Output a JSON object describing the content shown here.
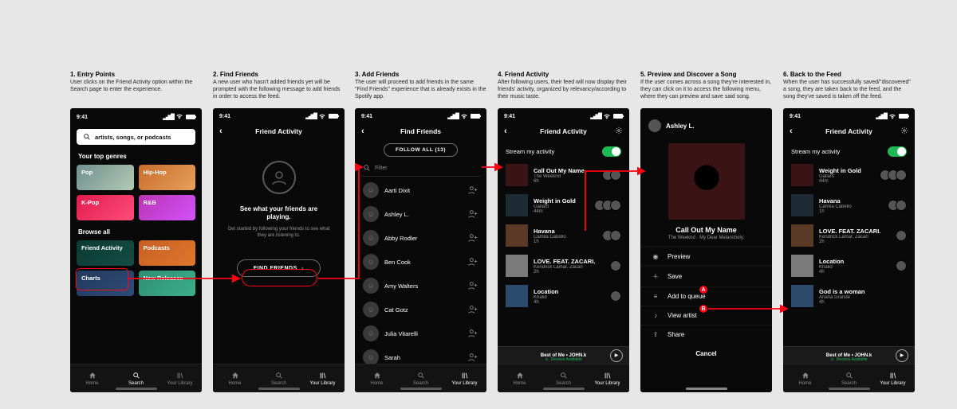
{
  "status_time": "9:41",
  "tabs": {
    "home": "Home",
    "search": "Search",
    "library": "Your Library"
  },
  "steps": [
    {
      "num": "1.",
      "title": "Entry Points",
      "body": "User clicks on the Friend Activity option within the Search page to enter the experience."
    },
    {
      "num": "2.",
      "title": "Find Friends",
      "body": "A new user who hasn't added friends yet will be prompted with the following message to add friends in order to access the feed."
    },
    {
      "num": "3.",
      "title": "Add Friends",
      "body": "The user will proceed to add friends in the same \"Find Friends\" experience that is already exists in the Spotify app."
    },
    {
      "num": "4.",
      "title": "Friend Activity",
      "body": "After following users, their feed will now display their friends' activity, organized by relevancy/according to their music taste."
    },
    {
      "num": "5.",
      "title": "Preview and Discover a Song",
      "body": "If the user comes across a song they're interested in, they can click on it to access the following menu, where they can preview and save said song."
    },
    {
      "num": "6.",
      "title": "Back to the Feed",
      "body": "When the user has successfully saved/\"discovered\" a song, they are taken back to the feed, and the song they've saved is taken off the feed."
    }
  ],
  "s1": {
    "search_placeholder": "artists, songs, or podcasts",
    "top_genres_h": "Your top genres",
    "top_genres": [
      {
        "label": "Pop",
        "color1": "#6f8f8f",
        "color2": "#b2cbb4"
      },
      {
        "label": "Hip-Hop",
        "color1": "#c96b2c",
        "color2": "#e6a25a"
      },
      {
        "label": "K-Pop",
        "color1": "#e11b4c",
        "color2": "#ff4d7a"
      },
      {
        "label": "R&B",
        "color1": "#b935b0",
        "color2": "#d451ff"
      }
    ],
    "browse_h": "Browse all",
    "browse": [
      {
        "label": "Friend Activity",
        "color1": "#0b3a33",
        "color2": "#134d44"
      },
      {
        "label": "Podcasts",
        "color1": "#c65f24",
        "color2": "#e0772c"
      },
      {
        "label": "Charts",
        "color1": "#233a5e",
        "color2": "#2e4a76"
      },
      {
        "label": "New Releases",
        "color1": "#2e8f71",
        "color2": "#3dae8a"
      }
    ]
  },
  "s2": {
    "title": "Friend Activity",
    "heading": "See what your friends are playing.",
    "sub": "Get started by following your friends to see what they are listening to.",
    "cta": "FIND FRIENDS"
  },
  "s3": {
    "title": "Find Friends",
    "follow_all": "FOLLOW ALL (13)",
    "filter": "Filter",
    "friends": [
      "Aarti Dixit",
      "Ashley L.",
      "Abby Rodler",
      "Ben Cook",
      "Amy Walters",
      "Cat Gotz",
      "Julia Vitarelli",
      "Sarah"
    ]
  },
  "s4": {
    "title": "Friend Activity",
    "stream": "Stream my activity",
    "feed": [
      {
        "song": "Call Out My Name",
        "artist": "The Weeknd",
        "time": "6h",
        "listeners": 2
      },
      {
        "song": "Weight in Gold",
        "artist": "Gallant",
        "time": "44m",
        "listeners": 3
      },
      {
        "song": "Havana",
        "artist": "Camila Cabello",
        "time": "1h",
        "listeners": 2
      },
      {
        "song": "LOVE. FEAT. ZACARI.",
        "artist": "Kendrick Lamar, Zacari",
        "time": "2h",
        "listeners": 1
      },
      {
        "song": "Location",
        "artist": "Khalid",
        "time": "4h",
        "listeners": 1
      }
    ],
    "now_playing": {
      "title": "Best of Me",
      "artist": "JOHN.k",
      "devices": "Devices Available"
    }
  },
  "s5": {
    "user": "Ashley L.",
    "song": "Call Out My Name",
    "sub": "The Weeknd · My Dear Melancholy,",
    "menu": [
      "Preview",
      "Save",
      "Add to queue",
      "View artist",
      "Share"
    ],
    "cancel": "Cancel"
  },
  "s6": {
    "title": "Friend Activity",
    "stream": "Stream my activity",
    "feed": [
      {
        "song": "Weight in Gold",
        "artist": "Gallant",
        "time": "44m",
        "listeners": 3
      },
      {
        "song": "Havana",
        "artist": "Camila Cabello",
        "time": "1h",
        "listeners": 2
      },
      {
        "song": "LOVE. FEAT. ZACARI.",
        "artist": "Kendrick Lamar, Zacari",
        "time": "2h",
        "listeners": 1
      },
      {
        "song": "Location",
        "artist": "Khalid",
        "time": "4h",
        "listeners": 1
      },
      {
        "song": "God is a woman",
        "artist": "Ariana Grande",
        "time": "4h",
        "listeners": 0
      }
    ],
    "now_playing": {
      "title": "Best of Me",
      "artist": "JOHN.k",
      "devices": "Devices Available"
    }
  },
  "badges": {
    "a": "A",
    "b": "B"
  }
}
